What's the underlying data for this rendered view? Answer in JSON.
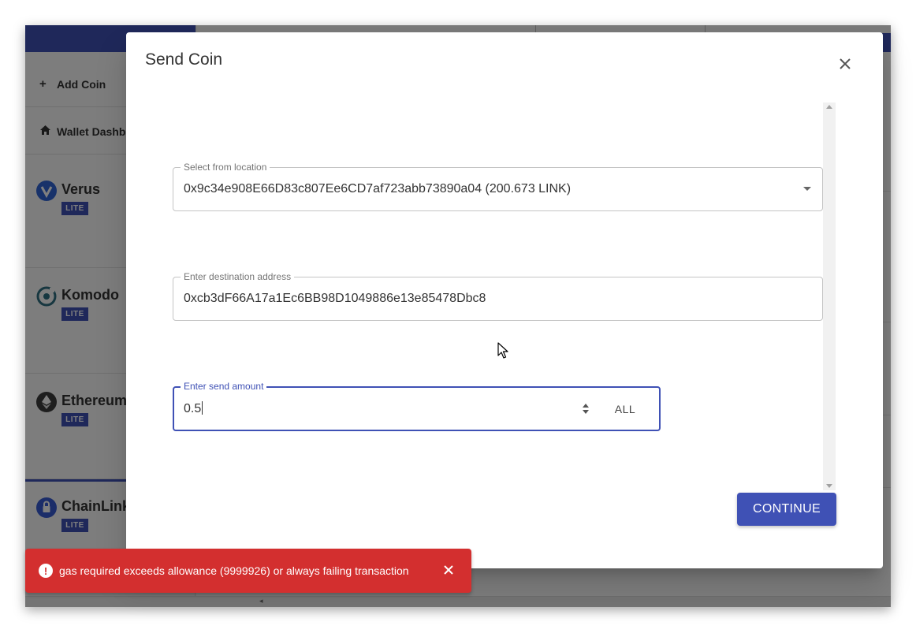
{
  "sidebar": {
    "add_coin_label": "Add Coin",
    "wallet_dashboard_label": "Wallet Dashb",
    "coins": [
      {
        "name": "Verus",
        "badge": "LITE",
        "color": "#3165d4"
      },
      {
        "name": "Komodo",
        "badge": "LITE",
        "color": "#2e6e80"
      },
      {
        "name": "Ethereum",
        "badge": "LITE",
        "color": "#3c3c3d"
      },
      {
        "name": "ChainLink",
        "badge": "LITE",
        "color": "#375bd2"
      }
    ]
  },
  "dialog": {
    "title": "Send Coin",
    "from_location": {
      "label": "Select from location",
      "value": "0x9c34e908E66D83c807Ee6CD7af723abb73890a04 (200.673 LINK)"
    },
    "destination": {
      "label": "Enter destination address",
      "value": "0xcb3dF66A17a1Ec6BB98D1049886e13e85478Dbc8"
    },
    "amount": {
      "label": "Enter send amount",
      "value": "0.5",
      "all_label": "ALL"
    },
    "continue_label": "CONTINUE"
  },
  "snackbar": {
    "message": "gas required exceeds allowance (9999926) or always failing transaction"
  },
  "colors": {
    "accent": "#3f51b5",
    "error": "#d32f2f"
  }
}
